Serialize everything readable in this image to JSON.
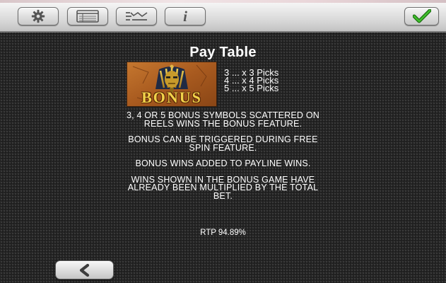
{
  "toolbar": {
    "buttons": [
      {
        "icon": "gear-icon"
      },
      {
        "icon": "paytable-icon"
      },
      {
        "icon": "rules-icon"
      },
      {
        "icon": "info-icon",
        "glyph": "i"
      }
    ],
    "confirm_icon": "checkmark-icon"
  },
  "paytable": {
    "title": "Pay Table",
    "symbol_label": "BONUS",
    "picks": [
      "3 ... x 3 Picks",
      "4 ... x 4 Picks",
      "5 ... x 5 Picks"
    ],
    "rules": [
      [
        "3, 4 OR 5 BONUS SYMBOLS SCATTERED ON",
        "REELS WINS THE BONUS FEATURE."
      ],
      [
        "BONUS CAN BE TRIGGERED DURING FREE",
        "SPIN FEATURE."
      ],
      [
        "BONUS WINS ADDED TO PAYLINE WINS."
      ],
      [
        "WINS SHOWN IN THE BONUS GAME HAVE",
        "ALREADY BEEN MULTIPLIED BY THE TOTAL",
        "BET."
      ]
    ],
    "rtp": "RTP 94.89%"
  },
  "navigation": {
    "back_icon": "chevron-left-icon"
  },
  "colors": {
    "text": "#ffffff",
    "check": "#2e9a1f",
    "background": "#1c1c1c"
  }
}
